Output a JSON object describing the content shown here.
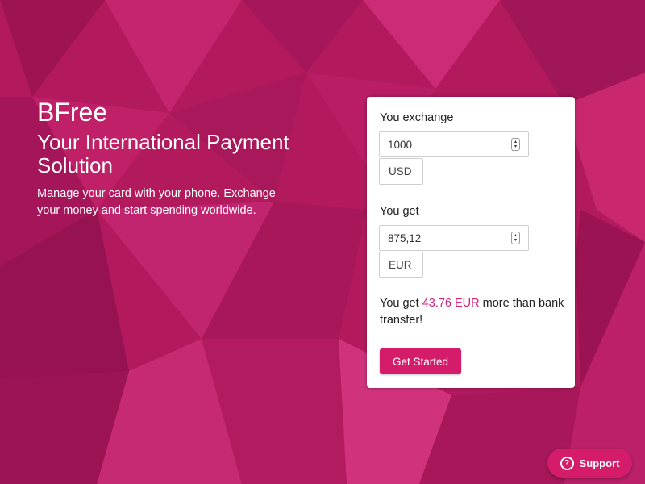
{
  "hero": {
    "brand": "BFree",
    "headline": "Your International Payment Solution",
    "description": "Manage your card with your phone. Exchange your money and start spending worldwide."
  },
  "converter": {
    "exchange_label": "You exchange",
    "exchange_amount": "1000",
    "exchange_currency": "USD",
    "get_label": "You get",
    "get_amount": "875,12",
    "get_currency": "EUR",
    "promo_prefix": "You get ",
    "promo_amount": "43.76 EUR",
    "promo_suffix": " more than bank transfer!",
    "cta_label": "Get Started"
  },
  "support": {
    "label": "Support",
    "icon": "question-circle-icon"
  },
  "colors": {
    "background": "#b3195d",
    "accent": "#d51c6b",
    "accent_text": "#d6247c",
    "card": "#ffffff"
  }
}
